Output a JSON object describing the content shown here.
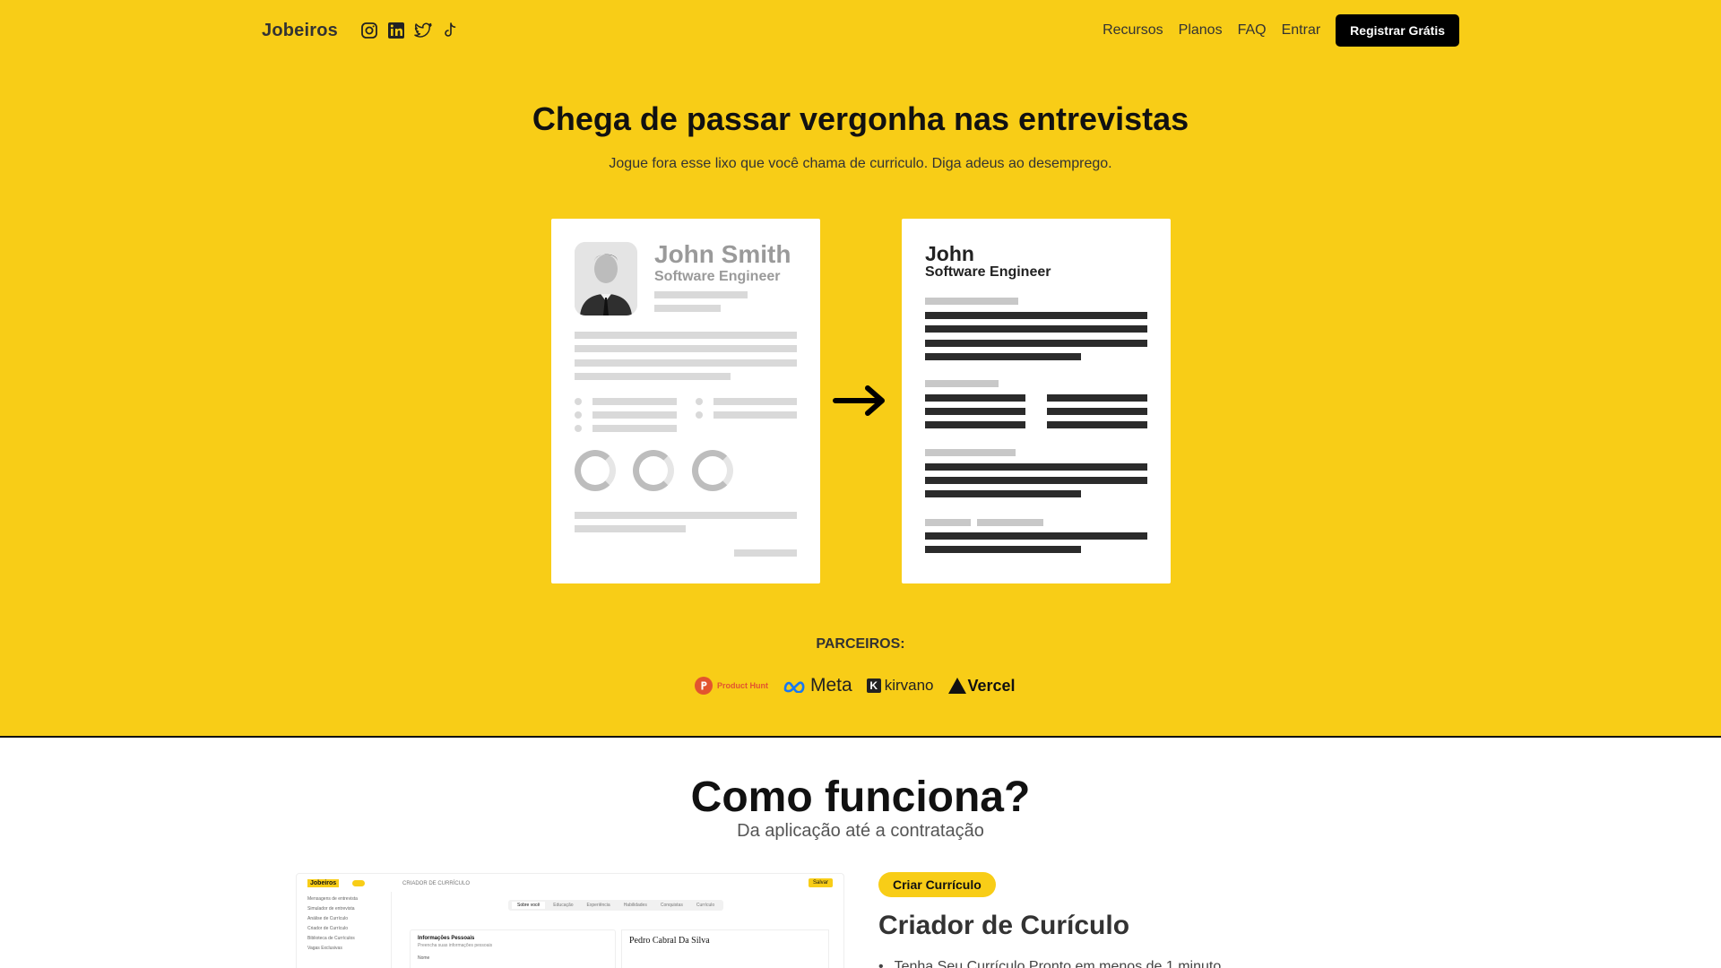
{
  "nav": {
    "logo": "Jobeiros",
    "socials": [
      "instagram-icon",
      "linkedin-icon",
      "twitter-icon",
      "tiktok-icon"
    ],
    "links": [
      "Recursos",
      "Planos",
      "FAQ",
      "Entrar"
    ],
    "cta": "Registrar Grátis"
  },
  "hero": {
    "title": "Chega de passar vergonha nas entrevistas",
    "subtitle": "Jogue fora esse lixo que você chama de curriculo. Diga adeus ao desemprego.",
    "before_card": {
      "name": "John Smith",
      "role": "Software Engineer"
    },
    "after_card": {
      "name": "John",
      "role": "Software Engineer"
    }
  },
  "partners": {
    "label": "PARCEIROS:",
    "logos": [
      "Product Hunt",
      "Meta",
      "kirvano",
      "Vercel"
    ]
  },
  "how": {
    "title": "Como funciona?",
    "subtitle": "Da aplicação até a contratação"
  },
  "app_preview": {
    "logo": "Jobeiros",
    "header": "CRIADOR DE CURRÍCULO",
    "save": "Salvar",
    "sidebar": [
      "Mensagens de entrevista",
      "Simulador de entrevista",
      "Análise de Currículo",
      "Criador de Currículo",
      "Biblioteca de Currículos",
      "Vagas Exclusivas"
    ],
    "tabs": [
      "Sobre você",
      "Educação",
      "Experiência",
      "Habilidades",
      "Conquistas",
      "Currículo"
    ],
    "form_title": "Informações Pessoais",
    "form_subtitle": "Preencha suas informações pessoais",
    "form_field": "Nome",
    "doc_name": "Pedro Cabral Da Silva"
  },
  "feature": {
    "badge": "Criar Currículo",
    "title": "Criador de Curículo",
    "bullet": "Tenha Seu Currículo Pronto em menos de 1 minuto"
  },
  "colors": {
    "brand": "#f8cd17",
    "dark": "#111111"
  }
}
